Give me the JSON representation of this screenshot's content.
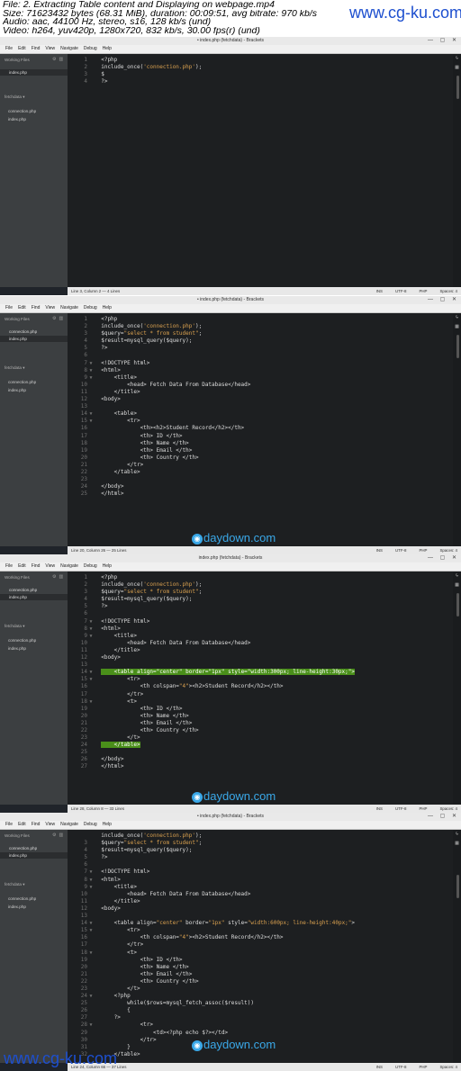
{
  "file_info": {
    "line1": "File: 2. Extracting Table content and Displaying on webpage.mp4",
    "line2": "Size: 71623432 bytes (68.31 MiB), duration: 00:09:51, avg bitrate: 970 kb/s",
    "line3": "Audio: aac, 44100 Hz, stereo, s16, 128 kb/s (und)",
    "line4": "Video: h264, yuv420p, 1280x720, 832 kb/s, 30.00 fps(r) (und)"
  },
  "watermark": "www.cg-ku.com",
  "daydown_logo": "daydown.com",
  "menu": [
    "File",
    "Edit",
    "Find",
    "View",
    "Navigate",
    "Debug",
    "Help"
  ],
  "sidebar": {
    "working_files_label": "Working Files",
    "project_label": "fetchdata",
    "project_files": [
      "connection.php",
      "index.php"
    ]
  },
  "frames": [
    {
      "title": "• index.php (fetchdata) - Brackets",
      "working_files": [
        "index.php"
      ],
      "status_left": "Line 3, Column 2 — 4 Lines",
      "status_right": [
        "INS",
        "UTF-8",
        "PHP",
        "Spaces: 4"
      ],
      "lines": [
        {
          "n": "1",
          "f": "",
          "t": "<?php"
        },
        {
          "n": "2",
          "f": "",
          "t": "include_once('connection.php');"
        },
        {
          "n": "3",
          "f": "",
          "t": "$"
        },
        {
          "n": "4",
          "f": "",
          "t": "?>"
        }
      ]
    },
    {
      "title": "• index.php (fetchdata) - Brackets",
      "working_files": [
        "connection.php",
        "index.php"
      ],
      "status_left": "Line 20, Column 26 — 25 Lines",
      "status_right": [
        "INS",
        "UTF-8",
        "PHP",
        "Spaces: 4"
      ],
      "lines": [
        {
          "n": "1",
          "f": "",
          "t": "<?php"
        },
        {
          "n": "2",
          "f": "",
          "t": "include_once('connection.php');"
        },
        {
          "n": "3",
          "f": "",
          "t": "$query=\"select * from student\";"
        },
        {
          "n": "4",
          "f": "",
          "t": "$result=mysql_query($query);"
        },
        {
          "n": "5",
          "f": "",
          "t": "?>"
        },
        {
          "n": "6",
          "f": "",
          "t": ""
        },
        {
          "n": "7",
          "f": "▼",
          "t": "<!DOCTYPE html>"
        },
        {
          "n": "8",
          "f": "▼",
          "t": "<html>"
        },
        {
          "n": "9",
          "f": "▼",
          "t": "    <title>"
        },
        {
          "n": "10",
          "f": "",
          "t": "        <head> Fetch Data From Database</head>"
        },
        {
          "n": "11",
          "f": "",
          "t": "    </title>"
        },
        {
          "n": "12",
          "f": "",
          "t": "<body>"
        },
        {
          "n": "13",
          "f": "",
          "t": ""
        },
        {
          "n": "14",
          "f": "▼",
          "t": "    <table>"
        },
        {
          "n": "15",
          "f": "▼",
          "t": "        <tr>"
        },
        {
          "n": "16",
          "f": "",
          "t": "            <th><h2>Student Record</h2></th>"
        },
        {
          "n": "17",
          "f": "",
          "t": "            <th> ID </th>"
        },
        {
          "n": "18",
          "f": "",
          "t": "            <th> Name </th>"
        },
        {
          "n": "19",
          "f": "",
          "t": "            <th> Email </th>"
        },
        {
          "n": "20",
          "f": "",
          "t": "            <th> Country </th>"
        },
        {
          "n": "21",
          "f": "",
          "t": "        </tr>"
        },
        {
          "n": "22",
          "f": "",
          "t": "    </table>"
        },
        {
          "n": "23",
          "f": "",
          "t": ""
        },
        {
          "n": "24",
          "f": "",
          "t": "</body>"
        },
        {
          "n": "25",
          "f": "",
          "t": "</html>"
        }
      ]
    },
    {
      "title": "index.php (fetchdata) - Brackets",
      "working_files": [
        "connection.php",
        "index.php"
      ],
      "status_left": "Line 28, Column 8 — 33 Lines",
      "status_right": [
        "INS",
        "UTF-8",
        "PHP",
        "Spaces: 4"
      ],
      "lines": [
        {
          "n": "1",
          "f": "",
          "t": "<?php"
        },
        {
          "n": "2",
          "f": "",
          "t": "include_once('connection.php');"
        },
        {
          "n": "3",
          "f": "",
          "t": "$query=\"select * from student\";"
        },
        {
          "n": "4",
          "f": "",
          "t": "$result=mysql_query($query);"
        },
        {
          "n": "5",
          "f": "",
          "t": "?>"
        },
        {
          "n": "6",
          "f": "",
          "t": ""
        },
        {
          "n": "7",
          "f": "▼",
          "t": "<!DOCTYPE html>"
        },
        {
          "n": "8",
          "f": "▼",
          "t": "<html>"
        },
        {
          "n": "9",
          "f": "▼",
          "t": "    <title>"
        },
        {
          "n": "10",
          "f": "",
          "t": "        <head> Fetch Data From Database</head>"
        },
        {
          "n": "11",
          "f": "",
          "t": "    </title>"
        },
        {
          "n": "12",
          "f": "",
          "t": "<body>"
        },
        {
          "n": "13",
          "f": "",
          "t": ""
        },
        {
          "n": "14",
          "f": "▼",
          "t": "    <table align=\"center\" border=\"1px\" style=\"width:300px; line-height:30px;\">",
          "hl": true
        },
        {
          "n": "15",
          "f": "▼",
          "t": "        <tr>"
        },
        {
          "n": "16",
          "f": "",
          "t": "            <th colspan=\"4\"><h2>Student Record</h2></th>"
        },
        {
          "n": "17",
          "f": "",
          "t": "        </tr>"
        },
        {
          "n": "18",
          "f": "▼",
          "t": "        <t>"
        },
        {
          "n": "19",
          "f": "",
          "t": "            <th> ID </th>"
        },
        {
          "n": "20",
          "f": "",
          "t": "            <th> Name </th>"
        },
        {
          "n": "21",
          "f": "",
          "t": "            <th> Email </th>"
        },
        {
          "n": "22",
          "f": "",
          "t": "            <th> Country </th>"
        },
        {
          "n": "23",
          "f": "",
          "t": "        </t>"
        },
        {
          "n": "24",
          "f": "",
          "t": "    </table>",
          "hl": true
        },
        {
          "n": "25",
          "f": "",
          "t": ""
        },
        {
          "n": "26",
          "f": "",
          "t": "</body>"
        },
        {
          "n": "27",
          "f": "",
          "t": "</html>"
        }
      ]
    },
    {
      "title": "• index.php (fetchdata) - Brackets",
      "working_files": [
        "connection.php",
        "index.php"
      ],
      "status_left": "Line 24, Column 66 — 37 Lines",
      "status_right": [
        "INS",
        "UTF-8",
        "PHP",
        "Spaces: 4"
      ],
      "lines": [
        {
          "n": "",
          "f": "",
          "t": "include_once('connection.php');"
        },
        {
          "n": "3",
          "f": "",
          "t": "$query=\"select * from student\";"
        },
        {
          "n": "4",
          "f": "",
          "t": "$result=mysql_query($query);"
        },
        {
          "n": "5",
          "f": "",
          "t": "?>"
        },
        {
          "n": "6",
          "f": "",
          "t": ""
        },
        {
          "n": "7",
          "f": "▼",
          "t": "<!DOCTYPE html>"
        },
        {
          "n": "8",
          "f": "▼",
          "t": "<html>"
        },
        {
          "n": "9",
          "f": "▼",
          "t": "    <title>"
        },
        {
          "n": "10",
          "f": "",
          "t": "        <head> Fetch Data From Database</head>"
        },
        {
          "n": "11",
          "f": "",
          "t": "    </title>"
        },
        {
          "n": "12",
          "f": "",
          "t": "<body>"
        },
        {
          "n": "13",
          "f": "",
          "t": ""
        },
        {
          "n": "14",
          "f": "▼",
          "t": "    <table align=\"center\" border=\"1px\" style=\"width:600px; line-height:40px;\">"
        },
        {
          "n": "15",
          "f": "▼",
          "t": "        <tr>"
        },
        {
          "n": "16",
          "f": "",
          "t": "            <th colspan=\"4\"><h2>Student Record</h2></th>"
        },
        {
          "n": "17",
          "f": "",
          "t": "        </tr>"
        },
        {
          "n": "18",
          "f": "▼",
          "t": "        <t>"
        },
        {
          "n": "19",
          "f": "",
          "t": "            <th> ID </th>"
        },
        {
          "n": "20",
          "f": "",
          "t": "            <th> Name </th>"
        },
        {
          "n": "21",
          "f": "",
          "t": "            <th> Email </th>"
        },
        {
          "n": "22",
          "f": "",
          "t": "            <th> Country </th>"
        },
        {
          "n": "23",
          "f": "",
          "t": "        </t>"
        },
        {
          "n": "24",
          "f": "▼",
          "t": "    <?php"
        },
        {
          "n": "25",
          "f": "",
          "t": "        while($rows=mysql_fetch_assoc($result))"
        },
        {
          "n": "26",
          "f": "",
          "t": "        {"
        },
        {
          "n": "27",
          "f": "",
          "t": "    ?>"
        },
        {
          "n": "28",
          "f": "▼",
          "t": "            <tr>"
        },
        {
          "n": "29",
          "f": "",
          "t": "                <td><?php echo $?></td>"
        },
        {
          "n": "30",
          "f": "",
          "t": "            </tr>"
        },
        {
          "n": "31",
          "f": "",
          "t": "        }"
        },
        {
          "n": "32",
          "f": "",
          "t": "    </table>"
        }
      ]
    }
  ]
}
